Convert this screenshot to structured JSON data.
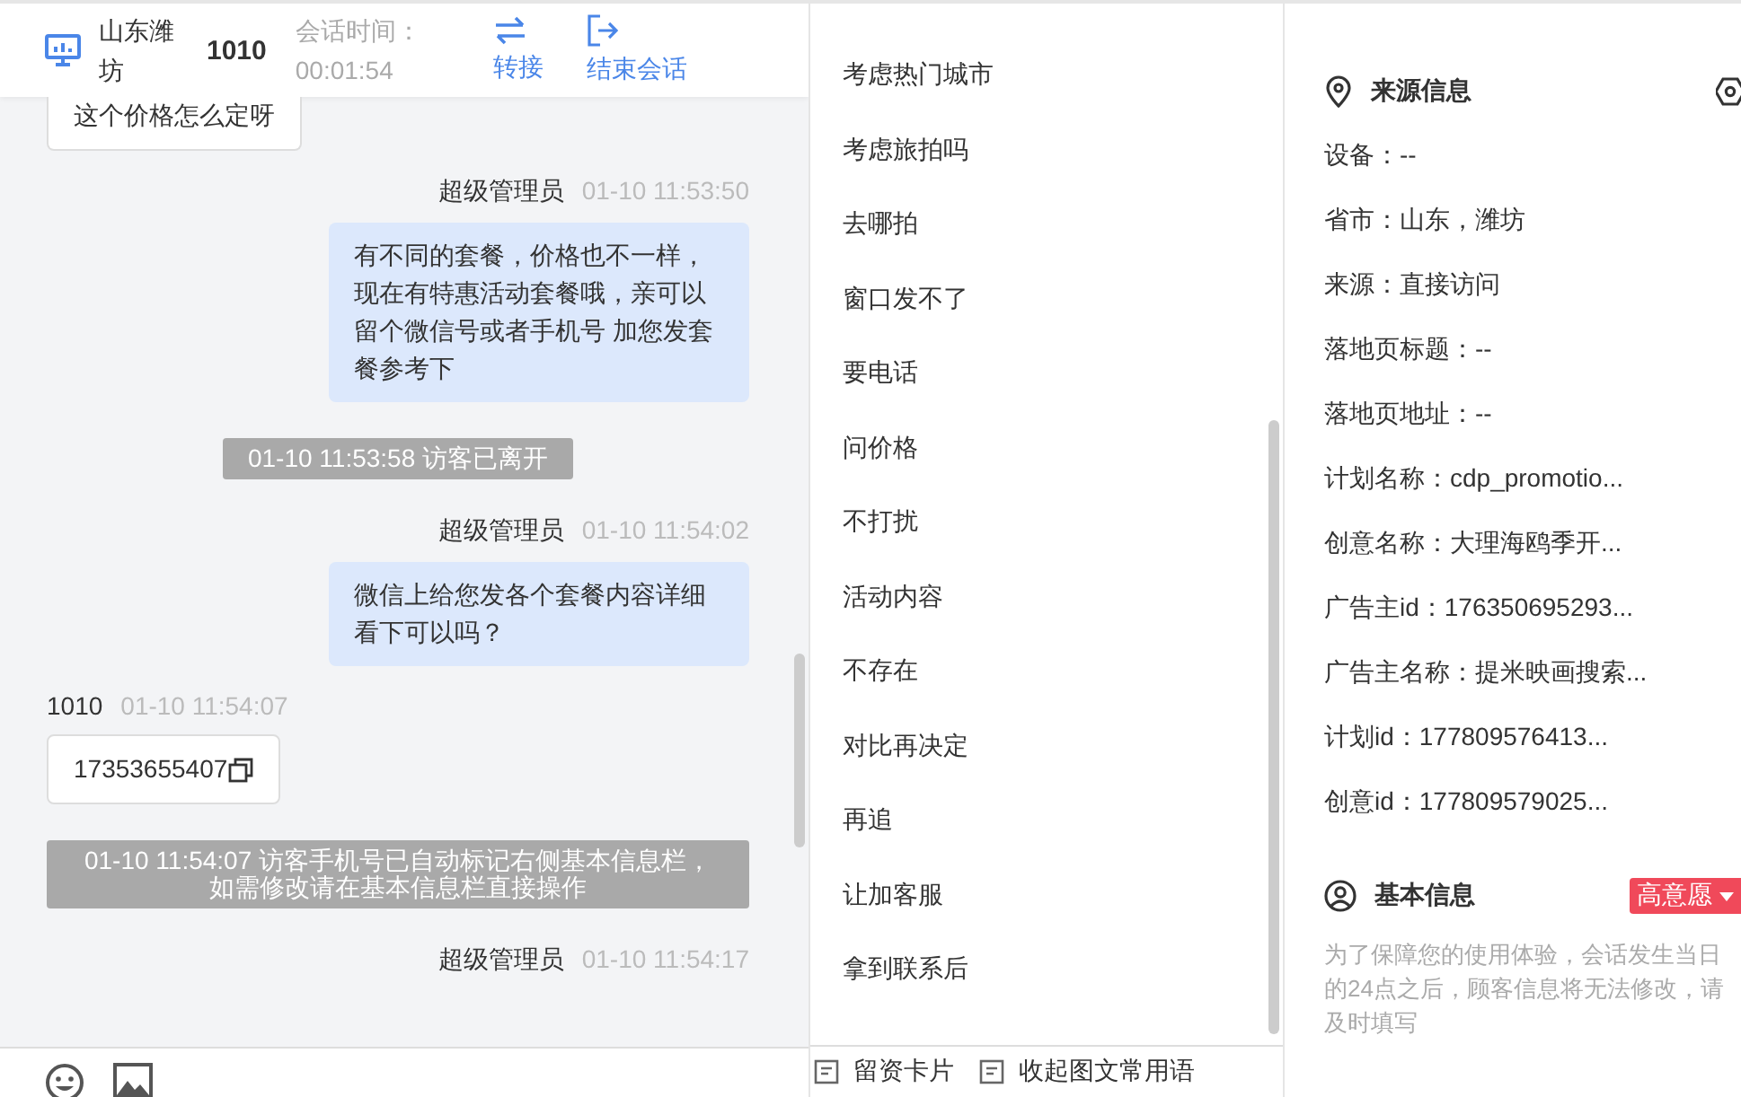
{
  "chat_header": {
    "location": "山东潍坊",
    "visitor": "1010",
    "session_label": "会话时间：",
    "session_time": "00:01:54",
    "actions": [
      {
        "kind": "transfer",
        "label": "转接"
      },
      {
        "kind": "end",
        "label": "结束会话"
      }
    ]
  },
  "messages": [
    {
      "kind": "visitor",
      "text": "这个价格怎么定呀"
    },
    {
      "kind": "agent",
      "sender": "超级管理员",
      "time": "01-10 11:53:50",
      "text": "有不同的套餐，价格也不一样，现在有特惠活动套餐哦，亲可以留个微信号或者手机号 加您发套餐参考下"
    },
    {
      "kind": "system",
      "text": "01-10 11:53:58 访客已离开"
    },
    {
      "kind": "agent",
      "sender": "超级管理员",
      "time": "01-10 11:54:02",
      "text": "微信上给您发各个套餐内容详细看下可以吗？"
    },
    {
      "kind": "visitor",
      "sender": "1010",
      "time": "01-10 11:54:07",
      "text": "17353655407",
      "copyable": true
    },
    {
      "kind": "system",
      "text": "01-10 11:54:07 访客手机号已自动标记右侧基本信息栏，如需修改请在基本信息栏直接操作"
    },
    {
      "kind": "agent",
      "sender": "超级管理员",
      "time": "01-10 11:54:17"
    }
  ],
  "quick_phrases": [
    "考虑热门城市",
    "考虑旅拍吗",
    "去哪拍",
    "窗口发不了",
    "要电话",
    "问价格",
    "不打扰",
    "活动内容",
    "不存在",
    "对比再决定",
    "再追",
    "让加客服",
    "拿到联系后"
  ],
  "bottom_tools": [
    "留资卡片",
    "收起图文常用语"
  ],
  "source_info": {
    "title": "来源信息",
    "fields": [
      "设备：--",
      "省市：山东，潍坊",
      "来源：直接访问",
      "落地页标题：--",
      "落地页地址：--",
      "计划名称：cdp_promotio...",
      "创意名称：大理海鸥季开...",
      "广告主id：176350695293...",
      "广告主名称：提米映画搜索...",
      "计划id：177809576413...",
      "创意id：177809579025..."
    ]
  },
  "basic_info": {
    "title": "基本信息",
    "intent": "高意愿",
    "note": "为了保障您的使用体验，会话发生当日的24点之后，顾客信息将无法修改，请及时填写"
  }
}
